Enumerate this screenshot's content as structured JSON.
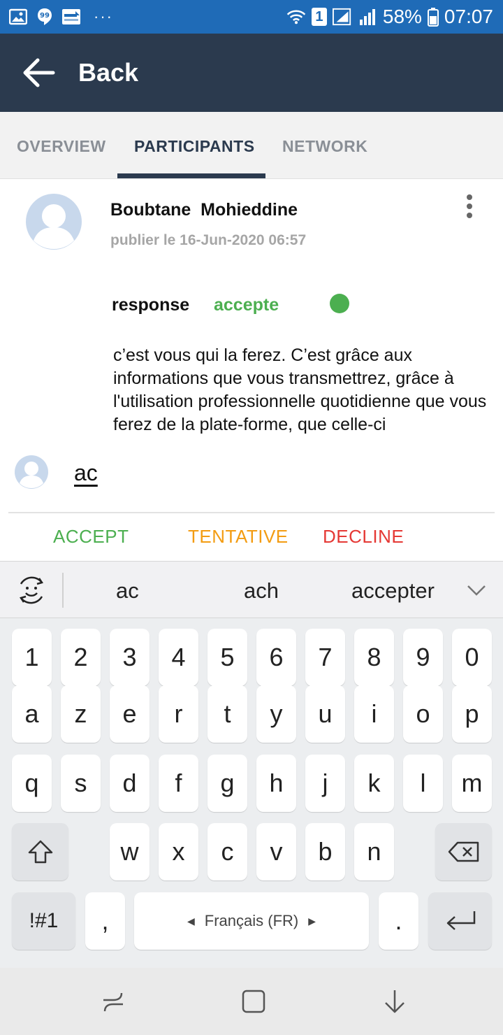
{
  "status_bar": {
    "battery": "58%",
    "time": "07:07",
    "sim": "1",
    "dots": "···",
    "left_icons": [
      "gallery-icon",
      "hangouts-icon",
      "app-icon"
    ]
  },
  "app_bar": {
    "back_label": "Back"
  },
  "tabs": [
    {
      "label": "OVERVIEW"
    },
    {
      "label": "PARTICIPANTS"
    },
    {
      "label": "NETWORK"
    }
  ],
  "post": {
    "author": "Boubtane  Mohieddine",
    "date": "publier le 16-Jun-2020 06:57",
    "response_label": "response",
    "response_value": "accepte",
    "body": "c’est vous qui la ferez. C’est grâce aux informations que vous transmettrez, grâce à l'utilisation professionnelle quotidienne que vous ferez de la plate-forme, que celle-ci"
  },
  "comment": {
    "value": "ac"
  },
  "actions": {
    "accept": "ACCEPT",
    "tentative": "TENTATIVE",
    "decline": "DECLINE"
  },
  "suggestions": [
    "ac",
    "ach",
    "accepter"
  ],
  "keyboard": {
    "row1": [
      "1",
      "2",
      "3",
      "4",
      "5",
      "6",
      "7",
      "8",
      "9",
      "0"
    ],
    "row2": [
      "a",
      "z",
      "e",
      "r",
      "t",
      "y",
      "u",
      "i",
      "o",
      "p"
    ],
    "row3": [
      "q",
      "s",
      "d",
      "f",
      "g",
      "h",
      "j",
      "k",
      "l",
      "m"
    ],
    "row4": [
      "w",
      "x",
      "c",
      "v",
      "b",
      "n"
    ],
    "symbols": "!#1",
    "comma": ",",
    "space": "Français (FR)",
    "period": "."
  },
  "colors": {
    "status_bar": "#1f6bb7",
    "app_bar": "#2b3a4e",
    "accept": "#4caf50",
    "tentative": "#f39c12",
    "decline": "#e53935"
  }
}
